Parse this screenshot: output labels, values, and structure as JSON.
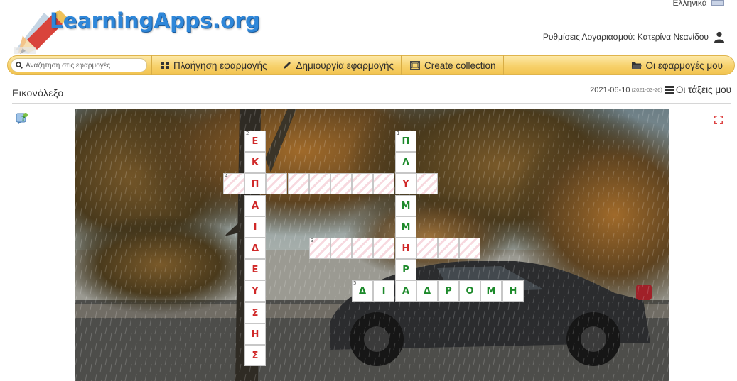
{
  "header": {
    "language_label": "Ελληνικά",
    "logo_text": "LearningApps.org",
    "account_text": "Ρυθμίσεις Λογαριασμού: Κατερίνα Νεανίδου"
  },
  "menu": {
    "search_placeholder": "Αναζήτηση στις εφαρμογές",
    "browse": "Πλοήγηση εφαρμογής",
    "create_app": "Δημιουργία εφαρμογής",
    "create_collection": "Create collection",
    "my_apps": "Οι εφαρμογές μου"
  },
  "page": {
    "title": "Εικονόλεξο",
    "date": "2021-06-10",
    "date_created": "(2021-03-26)",
    "my_classes": "Οι τάξεις μου"
  },
  "colors": {
    "menu_bar": "#f7d16b",
    "logo": "#2f87d9",
    "wrong_letter": "#d02828",
    "correct_letter": "#1d8a2b"
  },
  "crossword": {
    "words": [
      {
        "number": "1",
        "direction": "down",
        "answer_shown": "ΠΛΥΜΜΗΡ",
        "status": "correct"
      },
      {
        "number": "2",
        "direction": "down",
        "answer_shown": "ΕΚΠΑΙΔΕΥΣΗΣ",
        "status": "wrong"
      },
      {
        "number": "3",
        "direction": "across",
        "answer_shown": "",
        "status": "empty"
      },
      {
        "number": "4",
        "direction": "across",
        "answer_shown": "",
        "status": "empty"
      },
      {
        "number": "5",
        "direction": "across",
        "answer_shown": "ΔΙΑΔΡΟΜΗ",
        "status": "correct"
      }
    ],
    "cells": [
      {
        "r": 0,
        "c": 8,
        "l": "Π",
        "s": "right",
        "n": "1"
      },
      {
        "r": 1,
        "c": 8,
        "l": "Λ",
        "s": "right"
      },
      {
        "r": 2,
        "c": 8,
        "l": "Υ",
        "s": "wrong"
      },
      {
        "r": 3,
        "c": 8,
        "l": "Μ",
        "s": "right"
      },
      {
        "r": 4,
        "c": 8,
        "l": "Μ",
        "s": "right"
      },
      {
        "r": 5,
        "c": 8,
        "l": "Η",
        "s": "wrong"
      },
      {
        "r": 6,
        "c": 8,
        "l": "Ρ",
        "s": "right"
      },
      {
        "r": 7,
        "c": 8,
        "l": "Α",
        "s": "right"
      },
      {
        "r": 0,
        "c": 1,
        "l": "Ε",
        "s": "wrong",
        "n": "2"
      },
      {
        "r": 1,
        "c": 1,
        "l": "Κ",
        "s": "wrong"
      },
      {
        "r": 2,
        "c": 1,
        "l": "Π",
        "s": "wrong"
      },
      {
        "r": 3,
        "c": 1,
        "l": "Α",
        "s": "wrong"
      },
      {
        "r": 4,
        "c": 1,
        "l": "Ι",
        "s": "wrong"
      },
      {
        "r": 5,
        "c": 1,
        "l": "Δ",
        "s": "wrong"
      },
      {
        "r": 6,
        "c": 1,
        "l": "Ε",
        "s": "wrong"
      },
      {
        "r": 7,
        "c": 1,
        "l": "Υ",
        "s": "wrong"
      },
      {
        "r": 8,
        "c": 1,
        "l": "Σ",
        "s": "wrong"
      },
      {
        "r": 9,
        "c": 1,
        "l": "Η",
        "s": "wrong"
      },
      {
        "r": 10,
        "c": 1,
        "l": "Σ",
        "s": "wrong"
      },
      {
        "r": 2,
        "c": 0,
        "l": "",
        "s": "empty",
        "n": "4"
      },
      {
        "r": 2,
        "c": 2,
        "l": "",
        "s": "empty"
      },
      {
        "r": 2,
        "c": 3,
        "l": "",
        "s": "empty"
      },
      {
        "r": 2,
        "c": 4,
        "l": "",
        "s": "empty"
      },
      {
        "r": 2,
        "c": 5,
        "l": "",
        "s": "empty"
      },
      {
        "r": 2,
        "c": 6,
        "l": "",
        "s": "empty"
      },
      {
        "r": 2,
        "c": 7,
        "l": "",
        "s": "empty"
      },
      {
        "r": 2,
        "c": 9,
        "l": "",
        "s": "empty"
      },
      {
        "r": 5,
        "c": 4,
        "l": "",
        "s": "empty",
        "n": "3"
      },
      {
        "r": 5,
        "c": 5,
        "l": "",
        "s": "empty"
      },
      {
        "r": 5,
        "c": 6,
        "l": "",
        "s": "empty"
      },
      {
        "r": 5,
        "c": 7,
        "l": "",
        "s": "empty"
      },
      {
        "r": 5,
        "c": 9,
        "l": "",
        "s": "empty"
      },
      {
        "r": 5,
        "c": 10,
        "l": "",
        "s": "empty"
      },
      {
        "r": 5,
        "c": 11,
        "l": "",
        "s": "empty"
      },
      {
        "r": 7,
        "c": 6,
        "l": "Δ",
        "s": "right",
        "n": "5"
      },
      {
        "r": 7,
        "c": 7,
        "l": "Ι",
        "s": "right"
      },
      {
        "r": 7,
        "c": 9,
        "l": "Δ",
        "s": "right"
      },
      {
        "r": 7,
        "c": 10,
        "l": "Ρ",
        "s": "right"
      },
      {
        "r": 7,
        "c": 11,
        "l": "Ο",
        "s": "right"
      },
      {
        "r": 7,
        "c": 12,
        "l": "Μ",
        "s": "right"
      },
      {
        "r": 7,
        "c": 13,
        "l": "Η",
        "s": "right"
      }
    ]
  }
}
